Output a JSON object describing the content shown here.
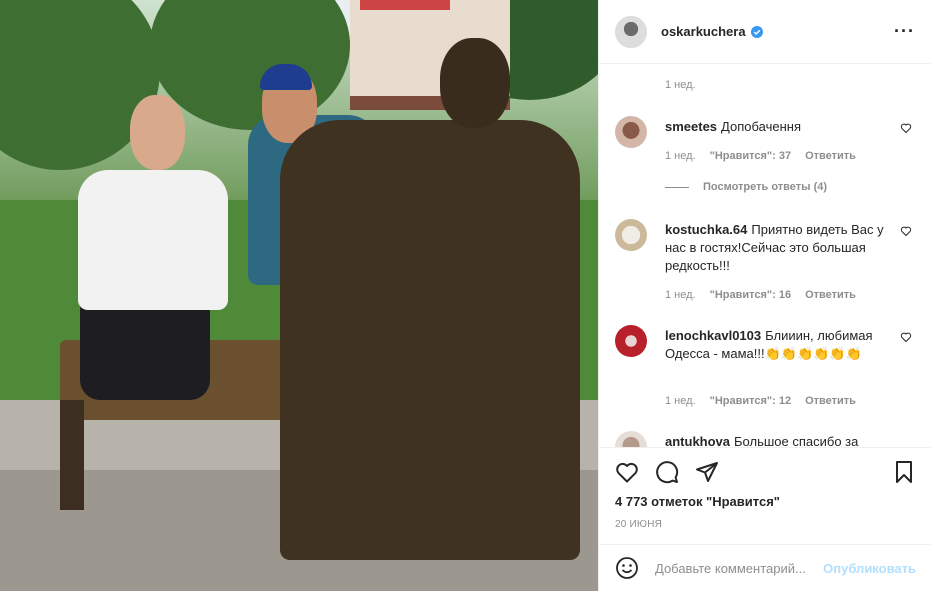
{
  "post": {
    "author": "oskarkuchera",
    "verified": true,
    "first_comment_time": "1 нед."
  },
  "comments": [
    {
      "username": "smeetes",
      "text": "Допобачення",
      "time": "1 нед.",
      "likes": "\"Нравится\": 37",
      "reply": "Ответить",
      "view_replies": "Посмотреть ответы (4)"
    },
    {
      "username": "kostuchka.64",
      "text": "Приятно видеть Вас у нас в гостях!Сейчас это большая редкость!!!",
      "time": "1 нед.",
      "likes": "\"Нравится\": 16",
      "reply": "Ответить"
    },
    {
      "username": "lenochkavl0103",
      "text": "Блииин, любимая Одесса - мама!!!👏👏👏👏👏👏",
      "time": "1 нед.",
      "likes": "\"Нравится\": 12",
      "reply": "Ответить"
    },
    {
      "username": "antukhova",
      "text": "Большое спасибо за"
    }
  ],
  "actions": {
    "likes_count": "4 773 отметок \"Нравится\"",
    "date": "20 июня"
  },
  "add_comment": {
    "placeholder": "Добавьте комментарий...",
    "post_label": "Опубликовать"
  },
  "colors": {
    "verified": "#3897f0",
    "muted": "#8e8e8e",
    "post_disabled": "#b2dffc"
  }
}
